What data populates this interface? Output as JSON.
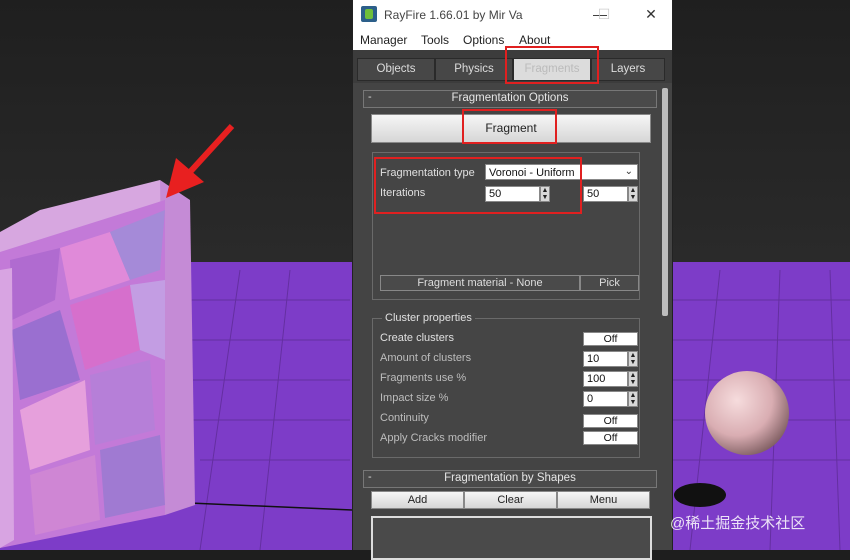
{
  "window": {
    "title": "RayFire 1.66.01  by Mir Va",
    "minimize_glyph": "—",
    "maximize_glyph": "☐",
    "close_glyph": "✕"
  },
  "menu": [
    "Manager",
    "Tools",
    "Options",
    "About"
  ],
  "tabs": [
    {
      "label": "Objects",
      "active": false
    },
    {
      "label": "Physics",
      "active": false
    },
    {
      "label": "Fragments",
      "active": true
    },
    {
      "label": "Layers",
      "active": false
    }
  ],
  "fragmentation_options": {
    "collapse_glyph": "-",
    "header": "Fragmentation Options",
    "fragment_button": "Fragment",
    "type_label": "Fragmentation type",
    "type_value": "Voronoi - Uniform",
    "iterations_label": "Iterations",
    "iterations_value_1": "50",
    "iterations_value_2": "50",
    "material_label": "Fragment material - None",
    "pick_label": "Pick"
  },
  "cluster_properties": {
    "title": "Cluster properties",
    "rows": [
      {
        "label": "Create clusters",
        "value": "Off",
        "kind": "button"
      },
      {
        "label": "Amount of clusters",
        "value": "10",
        "kind": "spinner"
      },
      {
        "label": "Fragments use %",
        "value": "100",
        "kind": "spinner"
      },
      {
        "label": "Impact size %",
        "value": "0",
        "kind": "spinner"
      },
      {
        "label": "Continuity",
        "value": "Off",
        "kind": "button"
      },
      {
        "label": "Apply Cracks modifier",
        "value": "Off",
        "kind": "button"
      }
    ]
  },
  "fragmentation_by_shapes": {
    "collapse_glyph": "-",
    "header": "Fragmentation by Shapes",
    "buttons": [
      "Add",
      "Clear",
      "Menu"
    ]
  },
  "watermark": "@稀土掘金技术社区",
  "colors": {
    "floor": "#7d3cc8",
    "highlight": "#e02020",
    "arrow": "#e82020"
  }
}
